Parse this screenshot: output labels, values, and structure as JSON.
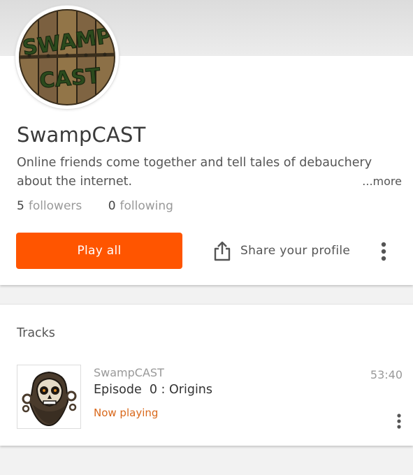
{
  "profile": {
    "avatar_logo_text_top": "SWAMP",
    "avatar_logo_text_bottom": "CAST",
    "username": "SwampCAST",
    "bio": "Online friends come together and tell tales of debauchery about the internet.",
    "more_label": "...more",
    "followers_count": "5",
    "followers_label": "followers",
    "following_count": "0",
    "following_label": "following"
  },
  "actions": {
    "play_all_label": "Play all",
    "share_label": "Share your profile",
    "share_icon": "share-upload-icon",
    "overflow_icon": "more-vertical-icon"
  },
  "tracks": {
    "section_title": "Tracks",
    "items": [
      {
        "artist": "SwampCAST",
        "title": "Episode  0 : Origins",
        "status": "Now playing",
        "duration": "53:40",
        "artwork_icon": "bearded-skull-illustration",
        "menu_icon": "more-vertical-icon"
      }
    ]
  },
  "colors": {
    "accent": "#ff5500",
    "now_playing": "#d9681b",
    "muted_text": "#999999",
    "page_background": "#f2f2f2"
  }
}
